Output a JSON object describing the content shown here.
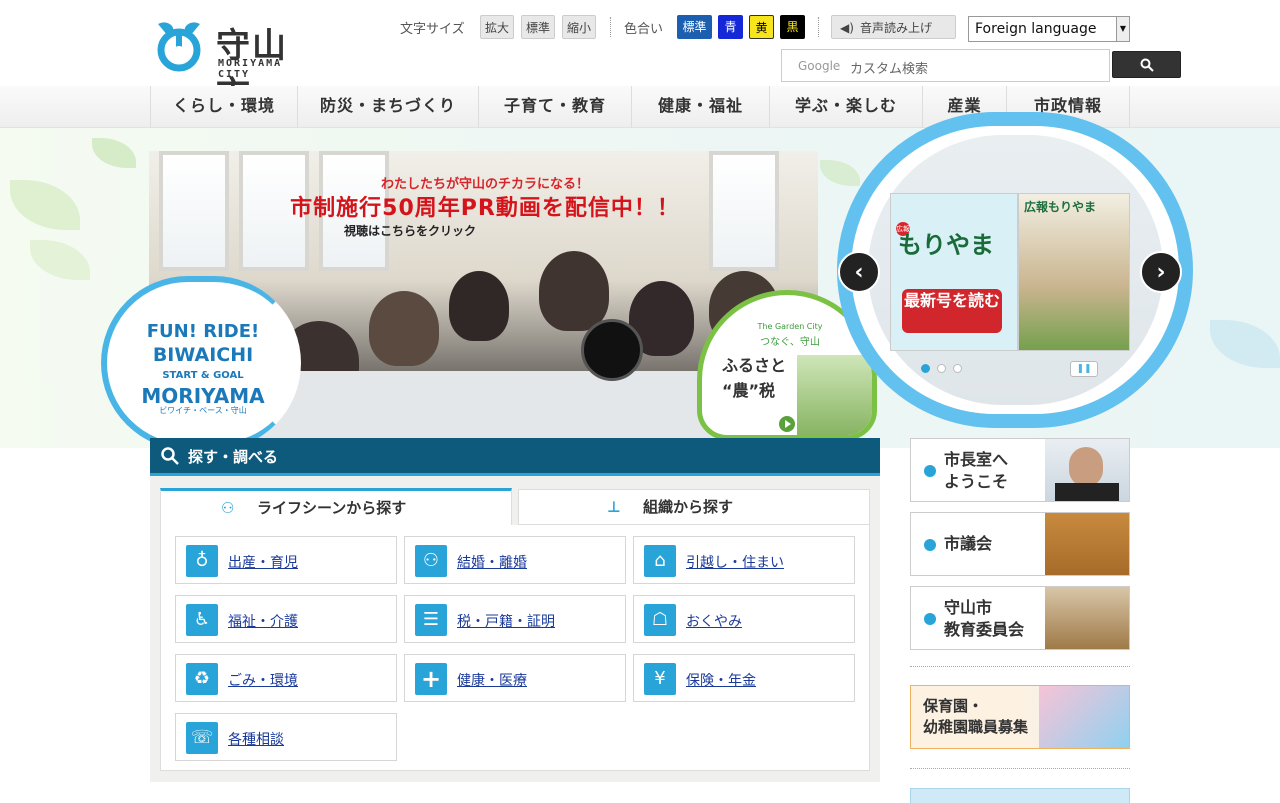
{
  "header": {
    "city_name": "守山市",
    "city_name_en": "MORIYAMA CITY",
    "font_size_label": "文字サイズ",
    "font_size_buttons": [
      "拡大",
      "標準",
      "縮小"
    ],
    "color_label": "色合い",
    "color_buttons": [
      {
        "label": "標準",
        "bg": "#1c5fb0",
        "fg": "#ffffff"
      },
      {
        "label": "青",
        "bg": "#1428d8",
        "fg": "#ffffff"
      },
      {
        "label": "黄",
        "bg": "#f7e51c",
        "fg": "#000000"
      },
      {
        "label": "黒",
        "bg": "#000000",
        "fg": "#f7e51c"
      }
    ],
    "read_aloud": "音声読み上げ",
    "language_select": "Foreign language",
    "search": {
      "brand": "Google",
      "placeholder": "カスタム検索",
      "button_icon": "search-icon"
    }
  },
  "nav": [
    "くらし・環境",
    "防災・まちづくり",
    "子育て・教育",
    "健康・福祉",
    "学ぶ・楽しむ",
    "産業",
    "市政情報"
  ],
  "hero": {
    "line1": "わたしたちが守山のチカラになる！",
    "line2": "市制施行50周年PR動画を配信中！！",
    "line3": "視聴はこちらをクリック"
  },
  "biwaichi": {
    "line1": "FUN! RIDE!",
    "line2": "BIWAICHI",
    "line3": "START & GOAL",
    "line4": "MORIYAMA",
    "line5": "ビワイチ・ベース・守山"
  },
  "furusato": {
    "sub1": "The Garden City",
    "sub2": "つなぐ、守山",
    "line1": "ふるさと",
    "line2": "“農”税"
  },
  "koho": {
    "tag": "広報",
    "title": "もりやま",
    "button": "最新号を読む",
    "mini_title": "広報もりやま"
  },
  "find": {
    "heading": "探す・調べる",
    "tab_life": "ライフシーンから探す",
    "tab_org": "組織から探す",
    "categories": [
      {
        "label": "出産・育児",
        "icon": "baby-bottle-icon"
      },
      {
        "label": "結婚・離婚",
        "icon": "couple-icon"
      },
      {
        "label": "引越し・住まい",
        "icon": "house-icon"
      },
      {
        "label": "福祉・介護",
        "icon": "wheelchair-icon"
      },
      {
        "label": "税・戸籍・証明",
        "icon": "document-icon"
      },
      {
        "label": "おくやみ",
        "icon": "memorial-icon"
      },
      {
        "label": "ごみ・環境",
        "icon": "garbage-bag-icon"
      },
      {
        "label": "健康・医療",
        "icon": "medical-cross-icon"
      },
      {
        "label": "保険・年金",
        "icon": "yen-bag-icon"
      },
      {
        "label": "各種相談",
        "icon": "consultation-icon"
      }
    ]
  },
  "side": {
    "mayor": "市長室へようこそ",
    "mayor_l1": "市長室へ",
    "mayor_l2": "ようこそ",
    "council": "市議会",
    "board_l1": "守山市",
    "board_l2": "教育委員会",
    "hoiku_l1": "保育園・",
    "hoiku_l2": "幼稚園職員募集"
  }
}
